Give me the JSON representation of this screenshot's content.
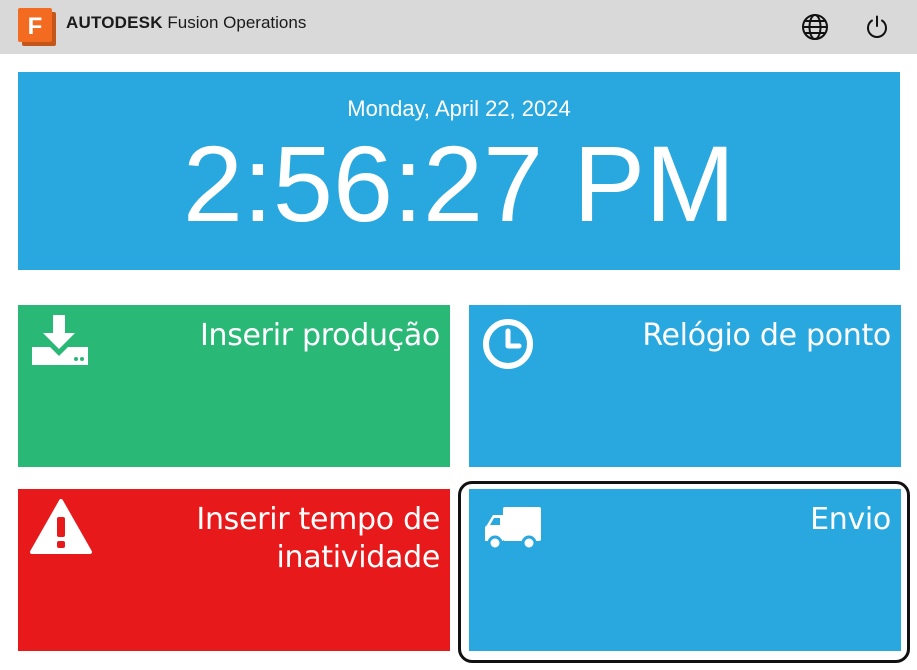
{
  "header": {
    "logo_letter": "F",
    "brand_strong": "AUTODESK",
    "brand_product": "Fusion Operations",
    "icons": [
      "globe-icon",
      "power-icon"
    ]
  },
  "clock": {
    "date": "Monday, April 22, 2024",
    "time": "2:56:27 PM"
  },
  "tiles": [
    {
      "label": "Inserir produção",
      "icon": "download-tray-icon",
      "color": "#2ab877"
    },
    {
      "label": "Relógio de ponto",
      "icon": "clock-icon",
      "color": "#29a8e0"
    },
    {
      "label_line1": "Inserir tempo de",
      "label_line2": "inatividade",
      "icon": "warning-icon",
      "color": "#e8191b"
    },
    {
      "label": "Envio",
      "icon": "truck-icon",
      "color": "#29a8e0",
      "focused": true
    }
  ],
  "colors": {
    "header_bg": "#d9d9d9",
    "logo_orange": "#f26b21",
    "accent_blue": "#29a8e0"
  }
}
